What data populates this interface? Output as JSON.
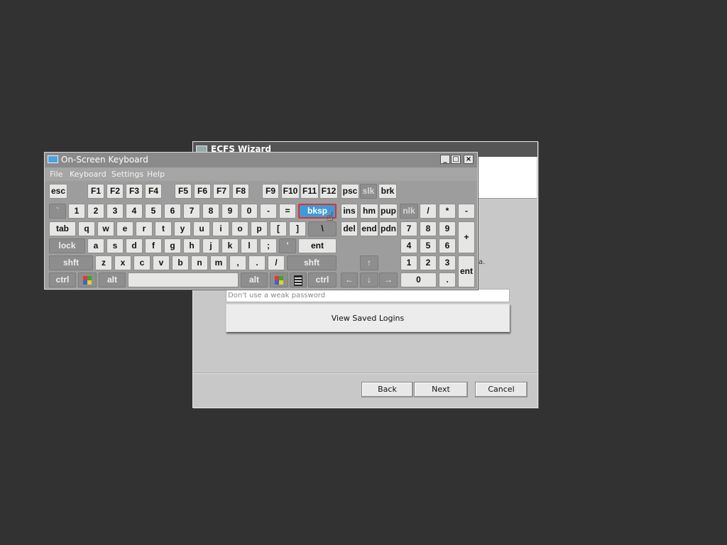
{
  "wizard": {
    "title": "ECFS Wizard",
    "partial_text": "a.",
    "password_placeholder": "Don't use a weak password",
    "view_saved_logins": "View Saved Logins",
    "back": "Back",
    "next": "Next",
    "cancel": "Cancel"
  },
  "osk": {
    "title": "On-Screen Keyboard",
    "title_buttons": {
      "minimize": "_",
      "maximize": "□",
      "close": "×"
    },
    "menu": [
      "File",
      "Keyboard",
      "Settings",
      "Help"
    ],
    "keys": {
      "esc": "esc",
      "f1": "F1",
      "f2": "F2",
      "f3": "F3",
      "f4": "F4",
      "f5": "F5",
      "f6": "F6",
      "f7": "F7",
      "f8": "F8",
      "f9": "F9",
      "f10": "F10",
      "f11": "F11",
      "f12": "F12",
      "psc": "psc",
      "slk": "slk",
      "brk": "brk",
      "backtick": "`",
      "n1": "1",
      "n2": "2",
      "n3": "3",
      "n4": "4",
      "n5": "5",
      "n6": "6",
      "n7": "7",
      "n8": "8",
      "n9": "9",
      "n0": "0",
      "minus": "-",
      "equals": "=",
      "bksp": "bksp",
      "ins": "ins",
      "hm": "hm",
      "pup": "pup",
      "nlk": "nlk",
      "np_div": "/",
      "np_mul": "*",
      "np_sub": "-",
      "tab": "tab",
      "q": "q",
      "w": "w",
      "e": "e",
      "r": "r",
      "t": "t",
      "y": "y",
      "u": "u",
      "i": "i",
      "o": "o",
      "p": "p",
      "lbr": "[",
      "rbr": "]",
      "bslash": "\\",
      "del": "del",
      "end": "end",
      "pdn": "pdn",
      "np7": "7",
      "np8": "8",
      "np9": "9",
      "np_add": "+",
      "lock": "lock",
      "a": "a",
      "s": "s",
      "d": "d",
      "f": "f",
      "g": "g",
      "h": "h",
      "j": "j",
      "k": "k",
      "l": "l",
      "semi": ";",
      "quote": "'",
      "ent": "ent",
      "np4": "4",
      "np5": "5",
      "np6": "6",
      "lshft": "shft",
      "z": "z",
      "x": "x",
      "c": "c",
      "v": "v",
      "b": "b",
      "n": "n",
      "m": "m",
      "comma": ",",
      "period": ".",
      "slash": "/",
      "rshft": "shft",
      "up": "↑",
      "np1": "1",
      "np2": "2",
      "np3": "3",
      "np_ent": "ent",
      "lctrl": "ctrl",
      "lalt": "alt",
      "space": "",
      "ralt": "alt",
      "rctrl": "ctrl",
      "left": "←",
      "down": "↓",
      "right": "→",
      "np0": "0",
      "np_dot": "."
    },
    "pressed_key": "bksp"
  },
  "colors": {
    "background": "#323232",
    "keyboard": "#9d9d9d",
    "pressed_key": "#3e9bd8",
    "pressed_outline": "#e03030"
  }
}
